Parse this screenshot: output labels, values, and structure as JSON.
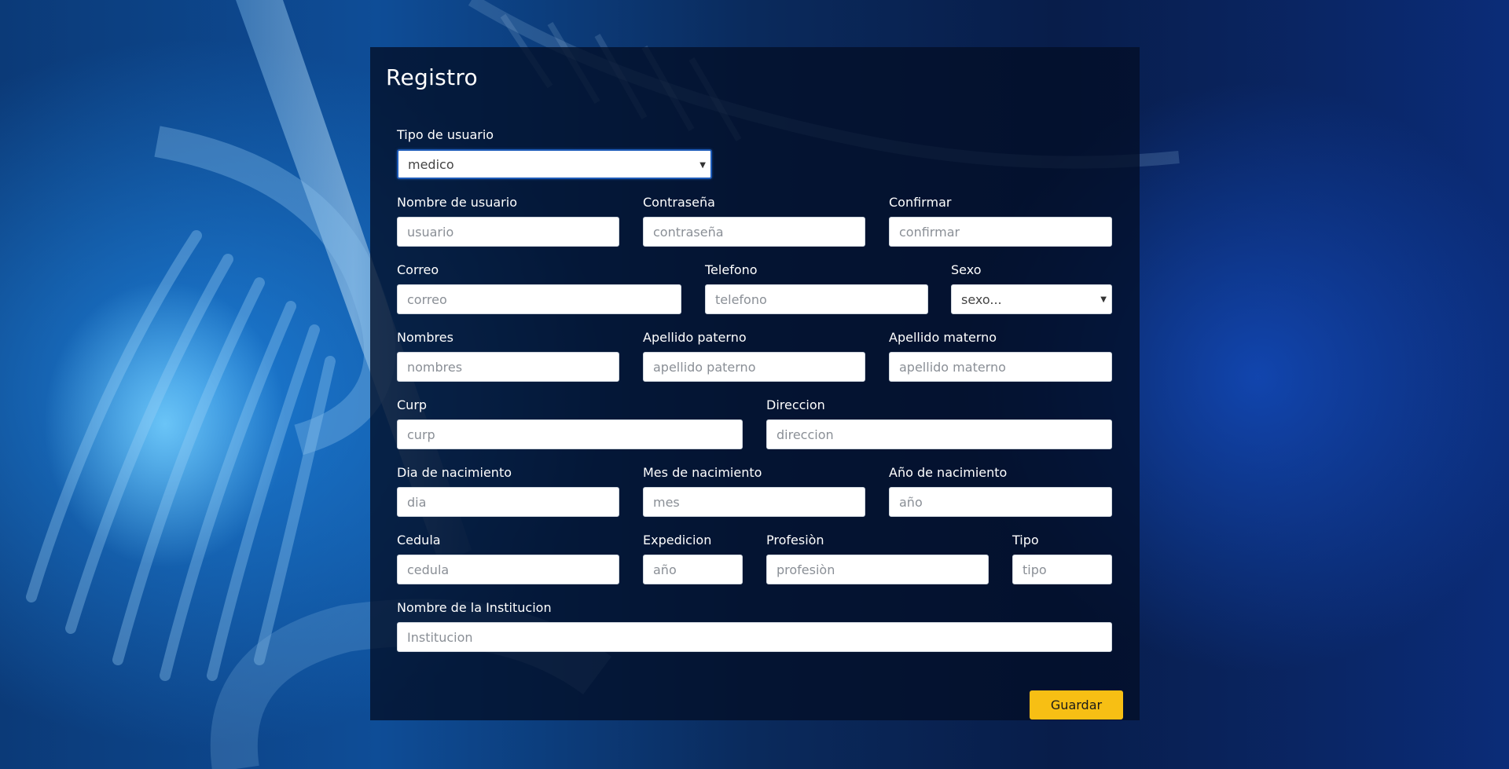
{
  "form": {
    "title": "Registro",
    "tipo_usuario": {
      "label": "Tipo de usuario",
      "value": "medico"
    },
    "usuario": {
      "label": "Nombre de usuario",
      "placeholder": "usuario"
    },
    "contrasena": {
      "label": "Contraseña",
      "placeholder": "contraseña"
    },
    "confirmar": {
      "label": "Confirmar",
      "placeholder": "confirmar"
    },
    "correo": {
      "label": "Correo",
      "placeholder": "correo"
    },
    "telefono": {
      "label": "Telefono",
      "placeholder": "telefono"
    },
    "sexo": {
      "label": "Sexo",
      "value": "sexo..."
    },
    "nombres": {
      "label": "Nombres",
      "placeholder": "nombres"
    },
    "apellido_paterno": {
      "label": "Apellido paterno",
      "placeholder": "apellido paterno"
    },
    "apellido_materno": {
      "label": "Apellido materno",
      "placeholder": "apellido materno"
    },
    "curp": {
      "label": "Curp",
      "placeholder": "curp"
    },
    "direccion": {
      "label": "Direccion",
      "placeholder": "direccion"
    },
    "dia": {
      "label": "Dia de nacimiento",
      "placeholder": "dia"
    },
    "mes": {
      "label": "Mes de nacimiento",
      "placeholder": "mes"
    },
    "anio": {
      "label": "Año de nacimiento",
      "placeholder": "año"
    },
    "cedula": {
      "label": "Cedula",
      "placeholder": "cedula"
    },
    "expedicion": {
      "label": "Expedicion",
      "placeholder": "año"
    },
    "profesion": {
      "label": "Profesiòn",
      "placeholder": "profesiòn"
    },
    "tipo": {
      "label": "Tipo",
      "placeholder": "tipo"
    },
    "institucion": {
      "label": "Nombre de la Institucion",
      "placeholder": "Institucion"
    },
    "save_label": "Guardar"
  },
  "colors": {
    "save_button": "#f7bf14",
    "panel": "#020e26"
  }
}
